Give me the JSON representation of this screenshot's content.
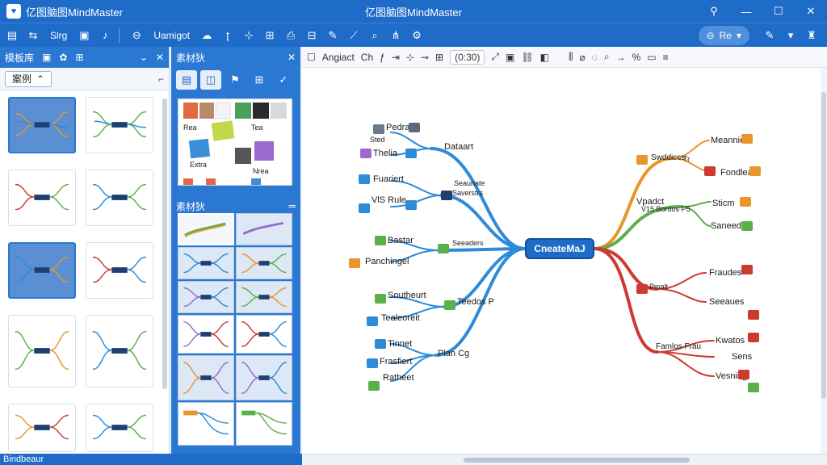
{
  "titlebar": {
    "app_name": "亿图脑图MindMaster",
    "window_title": "亿图脑图MindMaster",
    "logo_glyph": "♥",
    "controls": [
      "⚲",
      "—",
      "☐",
      "✕"
    ]
  },
  "toolbar": {
    "share_label": "Slrg",
    "upgrade_label": "Uamigot",
    "theme_label": "Re"
  },
  "templates_panel": {
    "title": "模板库",
    "filter_chip": "案例"
  },
  "materials_panel": {
    "title": "素材狄",
    "section2_title": "素材狄",
    "clipart_labels": [
      "Rea",
      "Tea",
      "Extra",
      "Nrea"
    ]
  },
  "canvas_toolbar": {
    "label1": "Angiact",
    "label2": "Ch",
    "zoom": "(0:30)"
  },
  "mindmap": {
    "center": "CneateMaJ",
    "nodes": [
      "Pedra",
      "Sted",
      "Thelia",
      "Fuariert",
      "VlS Rule",
      "Dataart",
      "Seaunate",
      "Saverstrs",
      "Bastar",
      "Panchingel",
      "Seeaders",
      "Southeurt",
      "Tealeoreit",
      "Teedos P",
      "Tinnet",
      "Frasfiert",
      "Ratheet",
      "Plan Cg",
      "Meannie",
      "Swddiccs",
      "Fondleat",
      "Vpadct",
      "V15 Bordos P5",
      "Sticm",
      "Saneed",
      "Fraudes",
      "Pmalt",
      "Seeaues",
      "Tr",
      "Famlos Frau",
      "Kwatos",
      "Sens",
      "Vesning"
    ]
  },
  "statusbar": {
    "text": "Bindbeaur"
  },
  "colors": {
    "brand": "#1e6cc8",
    "branch_blue": "#2e8bd8",
    "branch_orange": "#e8962a",
    "branch_green": "#5bb04a",
    "branch_red": "#cc3b2e"
  }
}
